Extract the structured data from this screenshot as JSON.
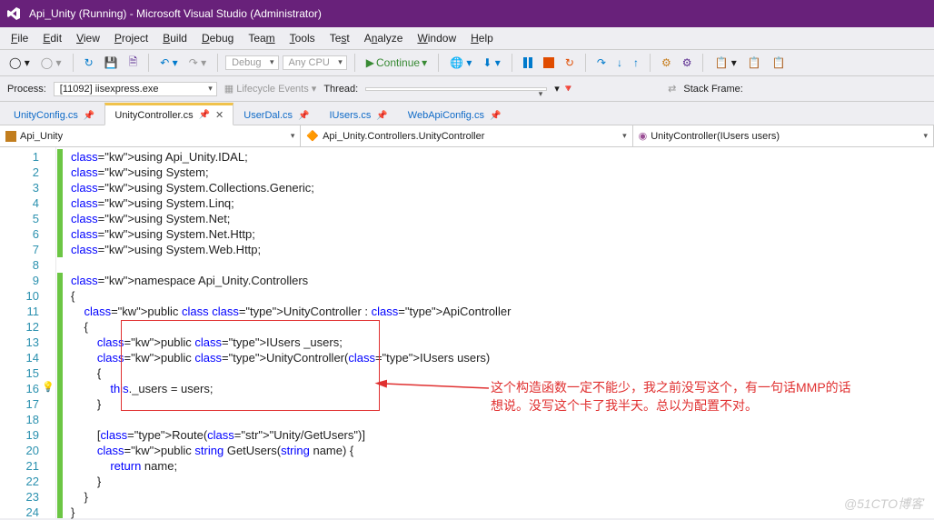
{
  "titlebar": {
    "title": "Api_Unity (Running) - Microsoft Visual Studio (Administrator)"
  },
  "menu": {
    "file": "File",
    "edit": "Edit",
    "view": "View",
    "project": "Project",
    "build": "Build",
    "debug": "Debug",
    "team": "Team",
    "tools": "Tools",
    "test": "Test",
    "analyze": "Analyze",
    "window": "Window",
    "help": "Help"
  },
  "toolbar": {
    "config": "Debug",
    "platform": "Any CPU",
    "continue": "Continue"
  },
  "debugbar": {
    "process_label": "Process:",
    "process": "[11092] iisexpress.exe",
    "lifecycle": "Lifecycle Events",
    "thread": "Thread:",
    "stack": "Stack Frame:"
  },
  "tabs": [
    {
      "label": "UnityConfig.cs",
      "pinned": true,
      "active": false
    },
    {
      "label": "UnityController.cs",
      "pinned": true,
      "active": true
    },
    {
      "label": "UserDal.cs",
      "pinned": true,
      "active": false
    },
    {
      "label": "IUsers.cs",
      "pinned": true,
      "active": false
    },
    {
      "label": "WebApiConfig.cs",
      "pinned": true,
      "active": false
    }
  ],
  "navbar": {
    "project": "Api_Unity",
    "class": "Api_Unity.Controllers.UnityController",
    "method": "UnityController(IUsers users)"
  },
  "code": {
    "lines": [
      {
        "n": 1,
        "t": "using Api_Unity.IDAL;"
      },
      {
        "n": 2,
        "t": "using System;"
      },
      {
        "n": 3,
        "t": "using System.Collections.Generic;"
      },
      {
        "n": 4,
        "t": "using System.Linq;"
      },
      {
        "n": 5,
        "t": "using System.Net;"
      },
      {
        "n": 6,
        "t": "using System.Net.Http;"
      },
      {
        "n": 7,
        "t": "using System.Web.Http;"
      },
      {
        "n": 8,
        "t": ""
      },
      {
        "n": 9,
        "t": "namespace Api_Unity.Controllers"
      },
      {
        "n": 10,
        "t": "{"
      },
      {
        "n": 11,
        "t": "    public class UnityController : ApiController"
      },
      {
        "n": 12,
        "t": "    {"
      },
      {
        "n": 13,
        "t": "        public IUsers _users;"
      },
      {
        "n": 14,
        "t": "        public UnityController(IUsers users)"
      },
      {
        "n": 15,
        "t": "        {"
      },
      {
        "n": 16,
        "t": "            this._users = users;"
      },
      {
        "n": 17,
        "t": "        }"
      },
      {
        "n": 18,
        "t": ""
      },
      {
        "n": 19,
        "t": "        [Route(\"Unity/GetUsers\")]"
      },
      {
        "n": 20,
        "t": "        public string GetUsers(string name) {"
      },
      {
        "n": 21,
        "t": "            return name;"
      },
      {
        "n": 22,
        "t": "        }"
      },
      {
        "n": 23,
        "t": "    }"
      },
      {
        "n": 24,
        "t": "}"
      }
    ]
  },
  "annotation": {
    "text_l1": "这个构造函数一定不能少，我之前没写这个，有一句话MMP的话",
    "text_l2": "想说。没写这个卡了我半天。总以为配置不对。"
  },
  "watermark": "@51CTO博客"
}
